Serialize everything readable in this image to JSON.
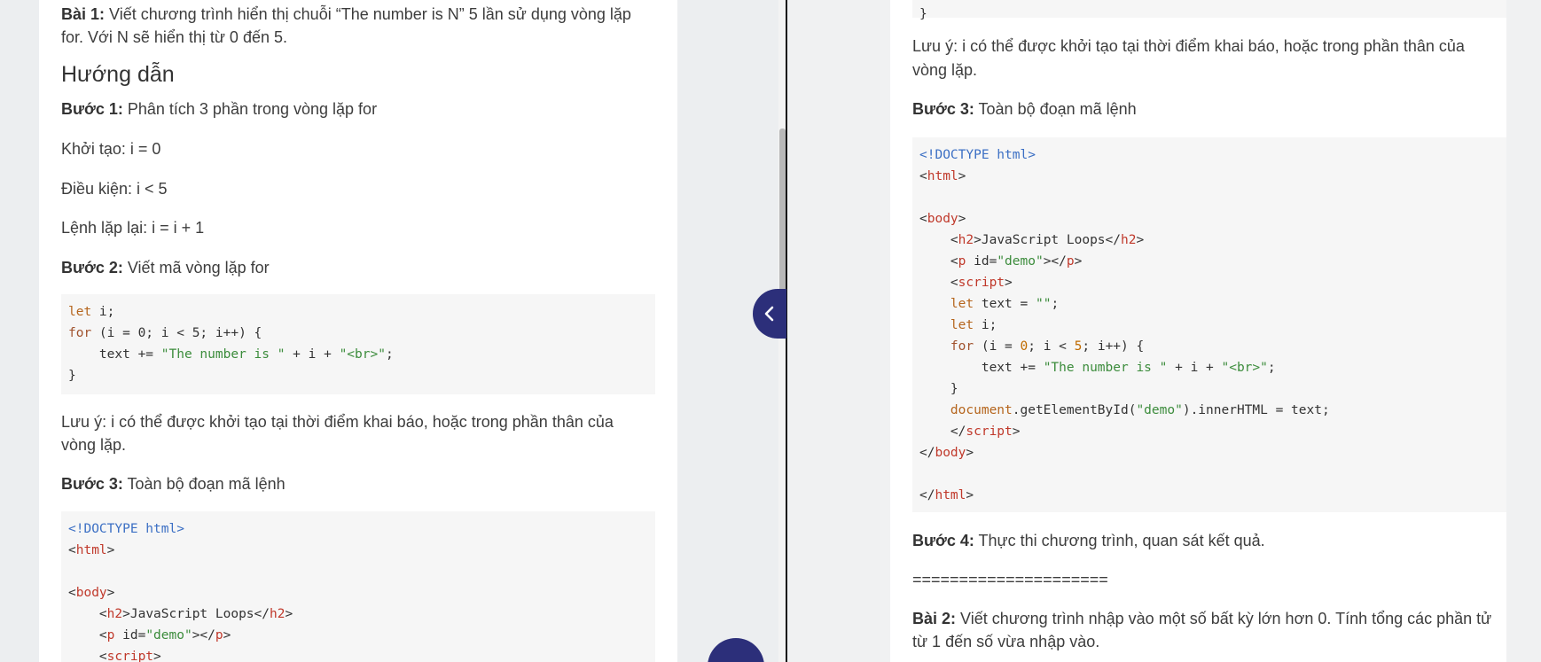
{
  "left": {
    "bai1_label": "Bài 1:",
    "bai1_text_line1": " Viết chương trình hiển thị chuỗi “The number is N” 5 lần sử dụng vòng lặp",
    "bai1_text_line2": "for. Với N sẽ hiển thị từ 0 đến 5.",
    "guide_heading": "Hướng dẫn",
    "step1_label": "Bước 1:",
    "step1_text": " Phân tích 3 phần trong vòng lặp for",
    "init_text": "Khởi tạo: i = 0",
    "cond_text": "Điều kiện: i < 5",
    "repeat_text": "Lệnh lặp lại: i = i + 1",
    "step2_label": "Bước 2:",
    "step2_text": " Viết mã vòng lặp for",
    "note_line1": "Lưu ý: i có thể được khởi tạo tại thời điểm khai báo, hoặc trong phần thân của",
    "note_line2": "vòng lặp.",
    "step3_label": "Bước 3:",
    "step3_text": " Toàn bộ đoạn mã lệnh"
  },
  "right": {
    "note_line1": "Lưu ý: i có thể được khởi tạo tại thời điểm khai báo, hoặc trong phần thân của",
    "note_line2": "vòng lặp.",
    "step3_label": "Bước 3:",
    "step3_text": " Toàn bộ đoạn mã lệnh",
    "step4_label": "Bước 4:",
    "step4_text": " Thực thi chương trình, quan sát kết quả.",
    "separator": "=====================",
    "bai2_label": "Bài 2:",
    "bai2_line1": " Viết chương trình nhập vào một số bất kỳ lớn hơn 0. Tính tổng các phần tử",
    "bai2_line2": "từ 1 đến số vừa nhập vào."
  },
  "code": {
    "let_kw": "let",
    "for_kw": "for",
    "let_i": " i;",
    "for_head": " (i = 0; i < 5; i++) {",
    "text_plus": "    text += ",
    "str_number": "\"The number is \"",
    "plus_i_plus": " + i + ",
    "str_br": "\"<br>\"",
    "semicolon": ";",
    "close_brace": "}",
    "doctype": "<!DOCTYPE html>",
    "html_open": "html",
    "body_open": "body",
    "h2": "h2",
    "h2_text": "JavaScript Loops",
    "p": "p",
    "id_attr": " id=",
    "demo_str": "\"demo\"",
    "script": "script",
    "let_text": " text = ",
    "empty_str": "\"\"",
    "for_zero": "0",
    "for_five": "5",
    "document_word": "document",
    "get_elem": ".getElementById(",
    "inner_html": ").innerHTML = text;",
    "top_brace": "}"
  },
  "colors": {
    "accent": "#2c2f7a",
    "code_bg": "#f6f6f6",
    "keyword": "#a0522d",
    "tag": "#c0392b",
    "string": "#3c8c3c",
    "doctype": "#3b6fc4"
  },
  "icons": {
    "collapse": "chevron-left-icon"
  }
}
